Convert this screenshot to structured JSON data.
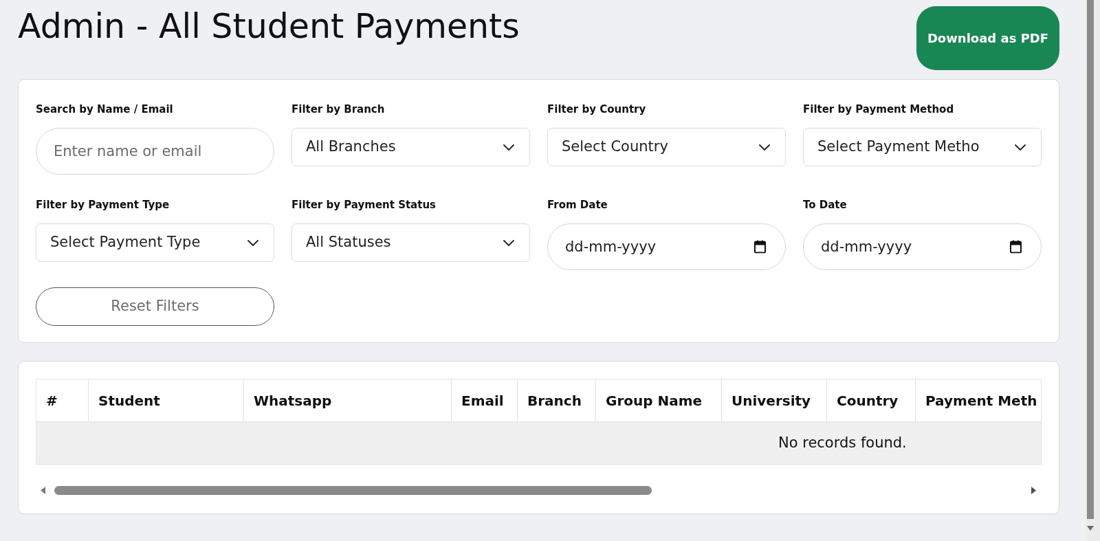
{
  "page": {
    "title": "Admin - All Student Payments",
    "download_button": "Download as PDF"
  },
  "filters": [
    {
      "kind": "search",
      "label": "Search by Name / Email",
      "placeholder": "Enter name or email"
    },
    {
      "kind": "select",
      "label": "Filter by Branch",
      "value": "All Branches"
    },
    {
      "kind": "select",
      "label": "Filter by Country",
      "value": "Select Country"
    },
    {
      "kind": "select",
      "label": "Filter by Payment Method",
      "value": "Select Payment Metho"
    },
    {
      "kind": "select",
      "label": "Filter by Payment Type",
      "value": "Select Payment Type"
    },
    {
      "kind": "select",
      "label": "Filter by Payment Status",
      "value": "All Statuses"
    },
    {
      "kind": "date",
      "label": "From Date",
      "placeholder": "dd-mm-yyyy"
    },
    {
      "kind": "date",
      "label": "To Date",
      "placeholder": "dd-mm-yyyy"
    }
  ],
  "reset_button": "Reset Filters",
  "table": {
    "columns": [
      "#",
      "Student",
      "Whatsapp",
      "Email",
      "Branch",
      "Group Name",
      "University",
      "Country",
      "Payment Meth"
    ],
    "empty_message": "No records found."
  }
}
